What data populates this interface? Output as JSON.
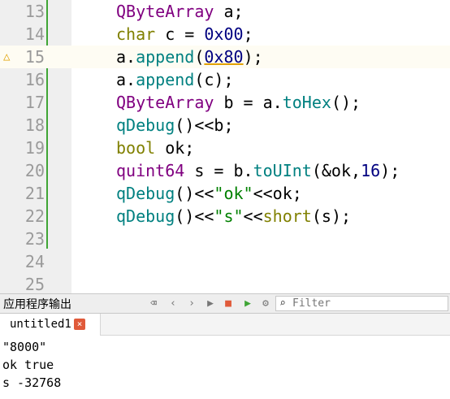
{
  "editor": {
    "lines": [
      {
        "no": "13",
        "tokens": [
          {
            "c": "t",
            "v": "QByteArray"
          },
          {
            "c": "op",
            "v": " a;"
          }
        ]
      },
      {
        "no": "14",
        "tokens": [
          {
            "c": "kw",
            "v": "char"
          },
          {
            "c": "op",
            "v": " c = "
          },
          {
            "c": "num",
            "v": "0x00"
          },
          {
            "c": "op",
            "v": ";"
          }
        ]
      },
      {
        "no": "15",
        "warn": true,
        "tokens": [
          {
            "c": "op",
            "v": "a."
          },
          {
            "c": "fn",
            "v": "append"
          },
          {
            "c": "op",
            "v": "("
          },
          {
            "c": "num u",
            "v": "0x80"
          },
          {
            "c": "op",
            "v": ");"
          }
        ]
      },
      {
        "no": "16",
        "tokens": [
          {
            "c": "op",
            "v": "a."
          },
          {
            "c": "fn",
            "v": "append"
          },
          {
            "c": "op",
            "v": "(c);"
          }
        ]
      },
      {
        "no": "17",
        "tokens": [
          {
            "c": "t",
            "v": "QByteArray"
          },
          {
            "c": "op",
            "v": " b = a."
          },
          {
            "c": "fn",
            "v": "toHex"
          },
          {
            "c": "op",
            "v": "();"
          }
        ]
      },
      {
        "no": "18",
        "tokens": [
          {
            "c": "fn",
            "v": "qDebug"
          },
          {
            "c": "op",
            "v": "()<<b;"
          }
        ]
      },
      {
        "no": "19",
        "tokens": [
          {
            "c": "kw",
            "v": "bool"
          },
          {
            "c": "op",
            "v": " ok;"
          }
        ]
      },
      {
        "no": "20",
        "tokens": [
          {
            "c": "t",
            "v": "quint64"
          },
          {
            "c": "op",
            "v": " s = b."
          },
          {
            "c": "fn",
            "v": "toUInt"
          },
          {
            "c": "op",
            "v": "(&ok,"
          },
          {
            "c": "num",
            "v": "16"
          },
          {
            "c": "op",
            "v": ");"
          }
        ]
      },
      {
        "no": "21",
        "tokens": [
          {
            "c": "fn",
            "v": "qDebug"
          },
          {
            "c": "op",
            "v": "()<<"
          },
          {
            "c": "str",
            "v": "\"ok\""
          },
          {
            "c": "op",
            "v": "<<ok;"
          }
        ]
      },
      {
        "no": "22",
        "tokens": [
          {
            "c": "fn",
            "v": "qDebug"
          },
          {
            "c": "op",
            "v": "()<<"
          },
          {
            "c": "str",
            "v": "\"s\""
          },
          {
            "c": "op",
            "v": "<<"
          },
          {
            "c": "kw",
            "v": "short"
          },
          {
            "c": "op",
            "v": "(s);"
          }
        ]
      },
      {
        "no": "23",
        "tokens": []
      },
      {
        "no": "24",
        "tokens": []
      },
      {
        "no": "25",
        "tokens": []
      }
    ]
  },
  "panel": {
    "title": "应用程序输出",
    "icons": [
      "clear-icon",
      "prev-icon",
      "next-icon",
      "run-icon",
      "stop-icon",
      "debug-run-icon",
      "settings-icon"
    ],
    "filter_placeholder": "Filter"
  },
  "tabs": [
    {
      "label": "untitled1",
      "close": "×"
    }
  ],
  "output": {
    "lines": [
      "\"8000\"",
      "ok true",
      "s -32768"
    ]
  },
  "colors": {
    "accent_green": "#3fa535",
    "warning": "#e1a100",
    "stop_red": "#e05a3a"
  }
}
